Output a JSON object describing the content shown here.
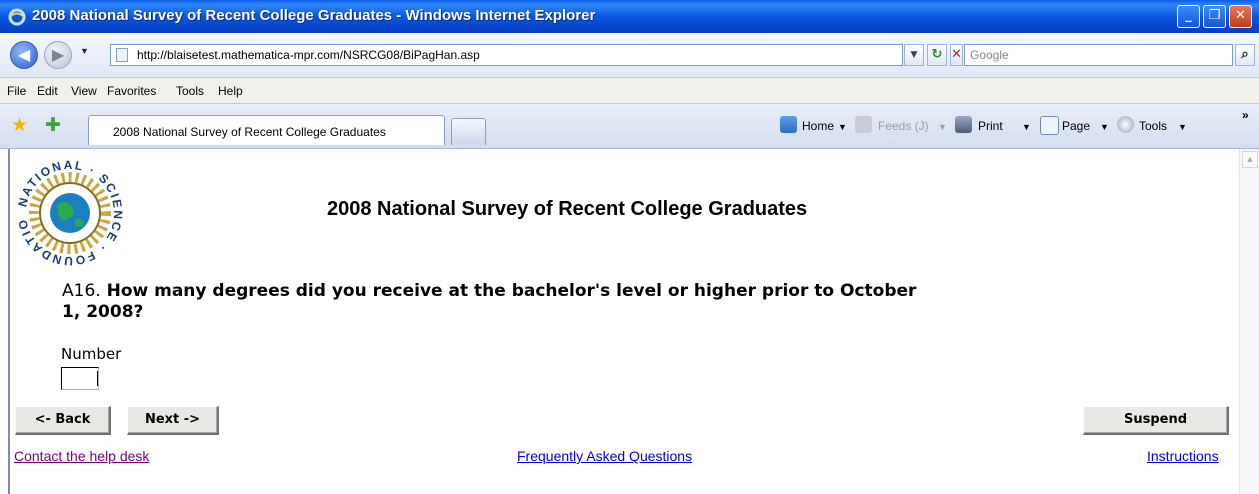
{
  "window": {
    "title": "2008 National Survey of Recent College Graduates - Windows Internet Explorer",
    "controls": [
      "_",
      "❐",
      "✕"
    ]
  },
  "address_bar": {
    "url": "http://blaisetest.mathematica-mpr.com/NSRCG08/BiPagHan.asp",
    "search_placeholder": "Google"
  },
  "menu": {
    "items": [
      "File",
      "Edit",
      "View",
      "Favorites",
      "Tools",
      "Help"
    ]
  },
  "tabs": {
    "active_label": "2008 National Survey of Recent College Graduates"
  },
  "command_bar": {
    "home": "Home",
    "feeds": "Feeds (J)",
    "print": "Print",
    "page": "Page",
    "tools": "Tools",
    "more": "»"
  },
  "page": {
    "logo_text": "NATIONAL SCIENCE FOUNDATION",
    "heading": "2008 National Survey of Recent College Graduates",
    "question_number": "A16.",
    "question_text": "How many degrees did you receive at the bachelor's level or higher prior to October 1, 2008?",
    "number_label": "Number",
    "number_value": "",
    "buttons": {
      "back": "<- Back",
      "next": "Next ->",
      "suspend": "Suspend"
    },
    "links": {
      "help_desk": "Contact the help desk",
      "faq": "Frequently Asked Questions",
      "instructions": "Instructions"
    }
  },
  "colors": {
    "titlebar": "#0b57dd",
    "link": "#0000ee",
    "visited_link": "#800080"
  }
}
